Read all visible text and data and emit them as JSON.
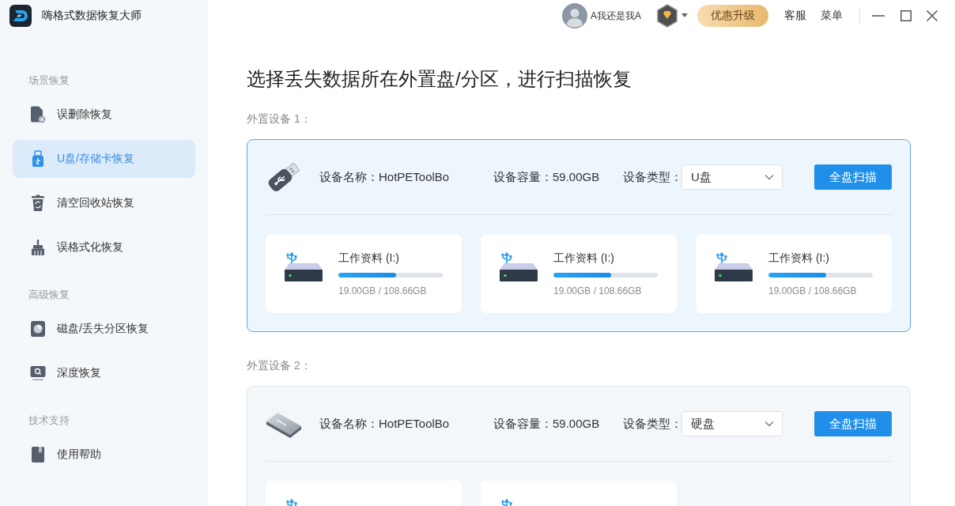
{
  "window": {
    "title": "嗨格式数据恢复大师"
  },
  "sidebar": {
    "sections": [
      {
        "heading": "场景恢复",
        "items": [
          {
            "label": "误删除恢复",
            "selected": false
          },
          {
            "label": "U盘/存储卡恢复",
            "selected": true
          },
          {
            "label": "清空回收站恢复",
            "selected": false
          },
          {
            "label": "误格式化恢复",
            "selected": false
          }
        ]
      },
      {
        "heading": "高级恢复",
        "items": [
          {
            "label": "磁盘/丢失分区恢复",
            "selected": false
          },
          {
            "label": "深度恢复",
            "selected": false
          }
        ]
      },
      {
        "heading": "技术支持",
        "items": [
          {
            "label": "使用帮助",
            "selected": false
          }
        ]
      }
    ]
  },
  "top_bar": {
    "user": "A我还是我A",
    "upgrade_button": "优惠升级",
    "links": [
      "客服",
      "菜单"
    ]
  },
  "main": {
    "title": "选择丢失数据所在外置盘/分区，进行扫描恢复",
    "devices": [
      {
        "label": "外置设备 1：",
        "selected": true,
        "kind": "usb",
        "name": "设备名称：HotPEToolBo",
        "capacity": "设备容量：59.00GB",
        "type_label": "设备类型：",
        "type": "U盘",
        "scan_button": "全盘扫描",
        "partitions": [
          {
            "kind": "usb",
            "name": "工作资料 (I:)",
            "level": 0.55,
            "usage": "19.00GB / 108.66GB"
          },
          {
            "kind": "usb",
            "name": "工作资料 (I:)",
            "level": 0.55,
            "usage": "19.00GB / 108.66GB"
          },
          {
            "kind": "usb",
            "name": "工作资料 (I:)",
            "level": 0.55,
            "usage": "19.00GB / 108.66GB"
          }
        ]
      },
      {
        "label": "外置设备 2：",
        "selected": false,
        "kind": "disk",
        "name": "设备名称：HotPEToolBo",
        "capacity": "设备容量：59.00GB",
        "type_label": "设备类型：",
        "type": "硬盘",
        "scan_button": "全盘扫描",
        "partitions": [
          {
            "kind": "usb"
          },
          {
            "kind": "usb"
          }
        ]
      }
    ]
  }
}
